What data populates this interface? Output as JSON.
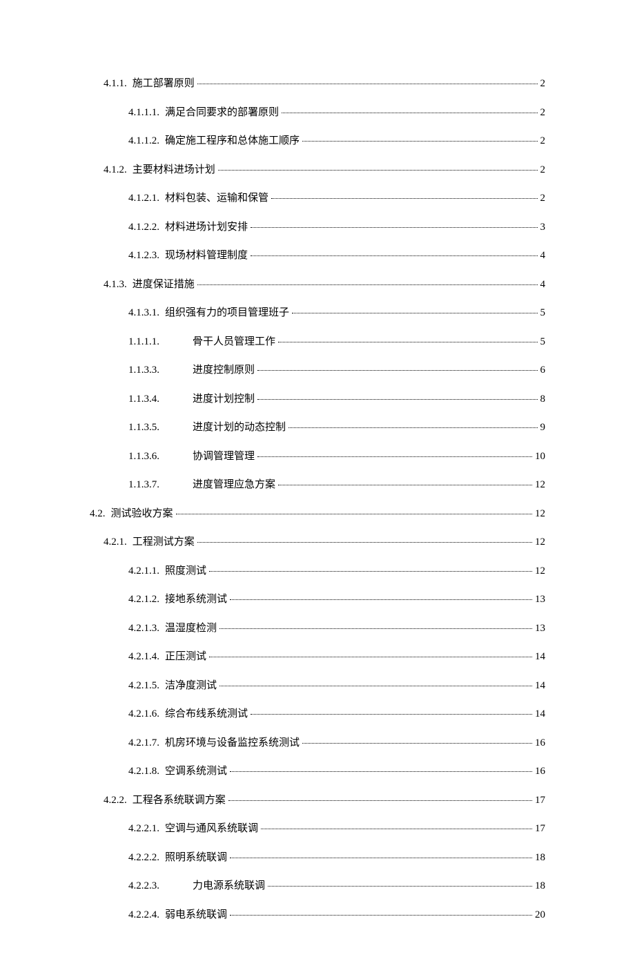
{
  "toc": [
    {
      "indent": "indent-1",
      "num": "4.1.1.",
      "title": "施工部署原则",
      "titleClass": "title",
      "page": "2"
    },
    {
      "indent": "indent-2",
      "num": "4.1.1.1.",
      "title": "满足合同要求的部署原则",
      "titleClass": "title",
      "page": "2"
    },
    {
      "indent": "indent-2",
      "num": "4.1.1.2.",
      "title": "确定施工程序和总体施工顺序",
      "titleClass": "title",
      "page": "2"
    },
    {
      "indent": "indent-1",
      "num": "4.1.2.",
      "title": "主要材料进场计划",
      "titleClass": "title",
      "page": "2"
    },
    {
      "indent": "indent-2",
      "num": "4.1.2.1.",
      "title": "材料包装、运输和保管",
      "titleClass": "title",
      "page": "2"
    },
    {
      "indent": "indent-2",
      "num": "4.1.2.2.",
      "title": "材料进场计划安排",
      "titleClass": "title",
      "page": "3"
    },
    {
      "indent": "indent-2",
      "num": "4.1.2.3.",
      "title": "现场材料管理制度",
      "titleClass": "title",
      "page": "4"
    },
    {
      "indent": "indent-1",
      "num": "4.1.3.",
      "title": "进度保证措施",
      "titleClass": "title",
      "page": "4"
    },
    {
      "indent": "indent-2",
      "num": "4.1.3.1.",
      "title": "组织强有力的项目管理班子",
      "titleClass": "title",
      "page": "5"
    },
    {
      "indent": "indent-3b",
      "num": "1.1.1.1.",
      "title": "骨干人员管理工作",
      "titleClass": "title-wide",
      "page": "5"
    },
    {
      "indent": "indent-3b",
      "num": "1.1.3.3.",
      "title": "进度控制原则",
      "titleClass": "title-wide",
      "page": "6"
    },
    {
      "indent": "indent-3b",
      "num": "1.1.3.4.",
      "title": "进度计划控制",
      "titleClass": "title-wide",
      "page": "8"
    },
    {
      "indent": "indent-3b",
      "num": "1.1.3.5.",
      "title": "进度计划的动态控制",
      "titleClass": "title-wide",
      "page": "9"
    },
    {
      "indent": "indent-3b",
      "num": "1.1.3.6.",
      "title": "协调管理管理",
      "titleClass": "title-wide",
      "page": "10"
    },
    {
      "indent": "indent-3b",
      "num": "1.1.3.7.",
      "title": "进度管理应急方案",
      "titleClass": "title-wide",
      "page": "12"
    },
    {
      "indent": "indent-0",
      "num": "4.2.",
      "title": "测试验收方案",
      "titleClass": "title",
      "page": "12"
    },
    {
      "indent": "indent-1",
      "num": "4.2.1.",
      "title": "工程测试方案",
      "titleClass": "title",
      "page": "12"
    },
    {
      "indent": "indent-2",
      "num": "4.2.1.1.",
      "title": "照度测试",
      "titleClass": "title",
      "page": "12"
    },
    {
      "indent": "indent-2",
      "num": "4.2.1.2.",
      "title": "接地系统测试",
      "titleClass": "title",
      "page": "13"
    },
    {
      "indent": "indent-2",
      "num": "4.2.1.3.",
      "title": "温湿度检测",
      "titleClass": "title",
      "page": "13"
    },
    {
      "indent": "indent-2",
      "num": "4.2.1.4.",
      "title": "正压测试",
      "titleClass": "title",
      "page": "14"
    },
    {
      "indent": "indent-2",
      "num": "4.2.1.5.",
      "title": "洁净度测试",
      "titleClass": "title",
      "page": "14"
    },
    {
      "indent": "indent-2",
      "num": "4.2.1.6.",
      "title": "综合布线系统测试",
      "titleClass": "title",
      "page": "14"
    },
    {
      "indent": "indent-2",
      "num": "4.2.1.7.",
      "title": "机房环境与设备监控系统测试",
      "titleClass": "title",
      "page": "16"
    },
    {
      "indent": "indent-2",
      "num": "4.2.1.8.",
      "title": "空调系统测试",
      "titleClass": "title",
      "page": "16"
    },
    {
      "indent": "indent-1",
      "num": "4.2.2.",
      "title": "工程各系统联调方案",
      "titleClass": "title",
      "page": "17"
    },
    {
      "indent": "indent-2",
      "num": "4.2.2.1.",
      "title": "空调与通风系统联调",
      "titleClass": "title",
      "page": "17"
    },
    {
      "indent": "indent-2",
      "num": "4.2.2.2.",
      "title": "照明系统联调",
      "titleClass": "title",
      "page": "18"
    },
    {
      "indent": "indent-2",
      "num": "4.2.2.3.",
      "title": "力电源系统联调",
      "titleClass": "title-wide",
      "page": "18"
    },
    {
      "indent": "indent-2",
      "num": "4.2.2.4.",
      "title": "弱电系统联调",
      "titleClass": "title",
      "page": "20"
    }
  ]
}
